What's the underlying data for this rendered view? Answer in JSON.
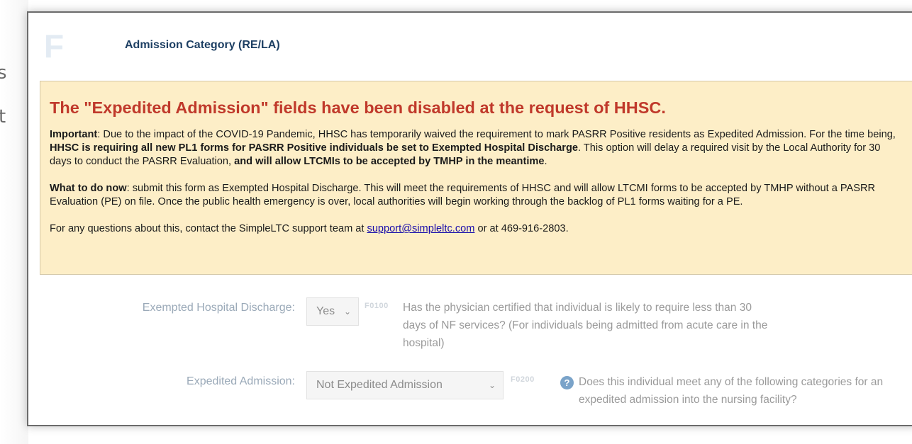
{
  "background": {
    "partial_text_1": "s",
    "partial_text_2": "t"
  },
  "section": {
    "letter": "F",
    "title": "Admission Category (RE/LA)"
  },
  "notice": {
    "heading": "The \"Expedited Admission\" fields have been disabled at the request of HHSC.",
    "p1": {
      "important_label": "Important",
      "text_a": ": Due to the impact of the COVID-19 Pandemic, HHSC has temporarily waived the requirement to mark PASRR Positive residents as Expedited Admission. For the time being, ",
      "bold_a": "HHSC is requiring all new PL1 forms for PASRR Positive individuals be set to Exempted Hospital Discharge",
      "text_b": ". This option will delay a required visit by the Local Authority for 30 days to conduct the PASRR Evaluation, ",
      "bold_b": "and will allow LTCMIs to be accepted by TMHP in the meantime",
      "text_c": "."
    },
    "p2": {
      "label": "What to do now",
      "text": ": submit this form as Exempted Hospital Discharge. This will meet the requirements of HHSC and will allow LTCMI forms to be accepted by TMHP without a PASRR Evaluation (PE) on file. Once the public health emergency is over, local authorities will begin working through the backlog of PL1 forms waiting for a PE."
    },
    "p3": {
      "text_a": "For any questions about this, contact the SimpleLTC support team at ",
      "email": "support@simpleltc.com",
      "text_b": " or at 469-916-2803."
    }
  },
  "fields": {
    "exempted": {
      "label": "Exempted Hospital Discharge:",
      "value": "Yes",
      "code": "F0100",
      "question": "Has the physician certified that individual is likely to require less than 30 days of NF services? (For individuals being admitted from acute care in the hospital)"
    },
    "expedited": {
      "label": "Expedited Admission:",
      "value": "Not Expedited Admission",
      "code": "F0200",
      "help_icon": "question-circle-icon",
      "question": "Does this individual meet any of the following categories for an expedited admission into the nursing facility?"
    }
  },
  "colors": {
    "notice_bg": "#fdeec7",
    "heading": "#c0392b",
    "title": "#1d3f63",
    "link": "#1a0dab"
  }
}
